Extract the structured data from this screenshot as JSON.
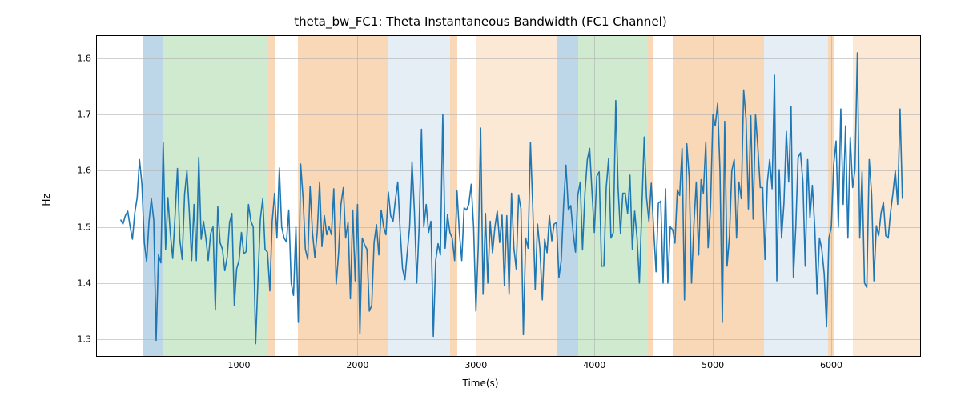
{
  "chart_data": {
    "type": "line",
    "title": "theta_bw_FC1: Theta Instantaneous Bandwidth (FC1 Channel)",
    "xlabel": "Time(s)",
    "ylabel": "Hz",
    "xlim": [
      -200,
      6750
    ],
    "ylim": [
      1.27,
      1.84
    ],
    "xticks": [
      1000,
      2000,
      3000,
      4000,
      5000,
      6000
    ],
    "yticks": [
      1.3,
      1.4,
      1.5,
      1.6,
      1.7,
      1.8
    ],
    "line_color": "#1f77b4",
    "regions": [
      {
        "start": 190,
        "end": 360,
        "color": "#bdd6e8"
      },
      {
        "start": 360,
        "end": 1250,
        "color": "#d0ead0"
      },
      {
        "start": 1250,
        "end": 1300,
        "color": "#f8d8b6"
      },
      {
        "start": 1500,
        "end": 2260,
        "color": "#f8d8b6"
      },
      {
        "start": 2260,
        "end": 2780,
        "color": "#e5edf5"
      },
      {
        "start": 2780,
        "end": 2840,
        "color": "#f8d8b6"
      },
      {
        "start": 3000,
        "end": 3680,
        "color": "#fbe9d5"
      },
      {
        "start": 3680,
        "end": 3860,
        "color": "#bdd6e8"
      },
      {
        "start": 3860,
        "end": 4450,
        "color": "#d0ead0"
      },
      {
        "start": 4450,
        "end": 4500,
        "color": "#f8d8b6"
      },
      {
        "start": 4660,
        "end": 5430,
        "color": "#f8d8b6"
      },
      {
        "start": 5430,
        "end": 5970,
        "color": "#e5edf5"
      },
      {
        "start": 5970,
        "end": 6020,
        "color": "#f8d8b6"
      },
      {
        "start": 6180,
        "end": 6750,
        "color": "#fbe9d5"
      }
    ],
    "series": [
      {
        "name": "theta_bw_FC1",
        "x_step": 20,
        "x_start": 0,
        "values": [
          1.513,
          1.505,
          1.52,
          1.528,
          1.501,
          1.478,
          1.525,
          1.552,
          1.62,
          1.576,
          1.472,
          1.438,
          1.51,
          1.55,
          1.512,
          1.298,
          1.45,
          1.436,
          1.65,
          1.46,
          1.552,
          1.488,
          1.444,
          1.52,
          1.604,
          1.478,
          1.442,
          1.558,
          1.6,
          1.526,
          1.44,
          1.54,
          1.44,
          1.624,
          1.478,
          1.51,
          1.48,
          1.44,
          1.488,
          1.5,
          1.352,
          1.536,
          1.472,
          1.46,
          1.422,
          1.446,
          1.508,
          1.524,
          1.36,
          1.425,
          1.44,
          1.49,
          1.452,
          1.456,
          1.54,
          1.51,
          1.5,
          1.292,
          1.408,
          1.514,
          1.55,
          1.46,
          1.455,
          1.386,
          1.51,
          1.56,
          1.48,
          1.605,
          1.5,
          1.48,
          1.473,
          1.53,
          1.4,
          1.378,
          1.5,
          1.33,
          1.612,
          1.552,
          1.46,
          1.442,
          1.572,
          1.49,
          1.445,
          1.49,
          1.58,
          1.465,
          1.52,
          1.486,
          1.5,
          1.486,
          1.568,
          1.398,
          1.452,
          1.54,
          1.57,
          1.48,
          1.508,
          1.372,
          1.53,
          1.404,
          1.54,
          1.31,
          1.48,
          1.468,
          1.46,
          1.35,
          1.36,
          1.472,
          1.504,
          1.45,
          1.53,
          1.5,
          1.486,
          1.562,
          1.52,
          1.51,
          1.548,
          1.58,
          1.492,
          1.426,
          1.406,
          1.454,
          1.5,
          1.616,
          1.53,
          1.4,
          1.498,
          1.674,
          1.5,
          1.54,
          1.49,
          1.51,
          1.305,
          1.44,
          1.47,
          1.45,
          1.7,
          1.462,
          1.522,
          1.49,
          1.48,
          1.44,
          1.564,
          1.49,
          1.44,
          1.534,
          1.53,
          1.54,
          1.576,
          1.5,
          1.35,
          1.468,
          1.676,
          1.38,
          1.524,
          1.4,
          1.51,
          1.454,
          1.5,
          1.528,
          1.472,
          1.521,
          1.395,
          1.52,
          1.38,
          1.56,
          1.462,
          1.425,
          1.556,
          1.532,
          1.308,
          1.48,
          1.462,
          1.65,
          1.534,
          1.388,
          1.505,
          1.46,
          1.37,
          1.478,
          1.454,
          1.52,
          1.475,
          1.505,
          1.508,
          1.41,
          1.44,
          1.54,
          1.61,
          1.53,
          1.538,
          1.49,
          1.455,
          1.556,
          1.58,
          1.459,
          1.56,
          1.62,
          1.64,
          1.56,
          1.49,
          1.59,
          1.598,
          1.43,
          1.43,
          1.57,
          1.622,
          1.48,
          1.49,
          1.725,
          1.57,
          1.488,
          1.56,
          1.56,
          1.524,
          1.592,
          1.46,
          1.528,
          1.48,
          1.4,
          1.53,
          1.66,
          1.552,
          1.51,
          1.578,
          1.496,
          1.42,
          1.542,
          1.546,
          1.4,
          1.568,
          1.4,
          1.5,
          1.495,
          1.471,
          1.566,
          1.556,
          1.64,
          1.37,
          1.648,
          1.588,
          1.4,
          1.505,
          1.58,
          1.45,
          1.584,
          1.56,
          1.65,
          1.463,
          1.535,
          1.7,
          1.68,
          1.72,
          1.6,
          1.33,
          1.688,
          1.43,
          1.484,
          1.6,
          1.62,
          1.48,
          1.58,
          1.55,
          1.744,
          1.692,
          1.532,
          1.698,
          1.514,
          1.7,
          1.64,
          1.57,
          1.57,
          1.442,
          1.58,
          1.62,
          1.568,
          1.77,
          1.404,
          1.602,
          1.48,
          1.542,
          1.67,
          1.58,
          1.714,
          1.41,
          1.5,
          1.624,
          1.632,
          1.58,
          1.43,
          1.62,
          1.516,
          1.574,
          1.5,
          1.38,
          1.48,
          1.46,
          1.416,
          1.322,
          1.48,
          1.5,
          1.61,
          1.653,
          1.5,
          1.71,
          1.54,
          1.68,
          1.48,
          1.66,
          1.57,
          1.602,
          1.81,
          1.48,
          1.598,
          1.4,
          1.392,
          1.62,
          1.558,
          1.404,
          1.502,
          1.484,
          1.525,
          1.544,
          1.484,
          1.48,
          1.526,
          1.56,
          1.6,
          1.54,
          1.71,
          1.55
        ]
      }
    ]
  }
}
